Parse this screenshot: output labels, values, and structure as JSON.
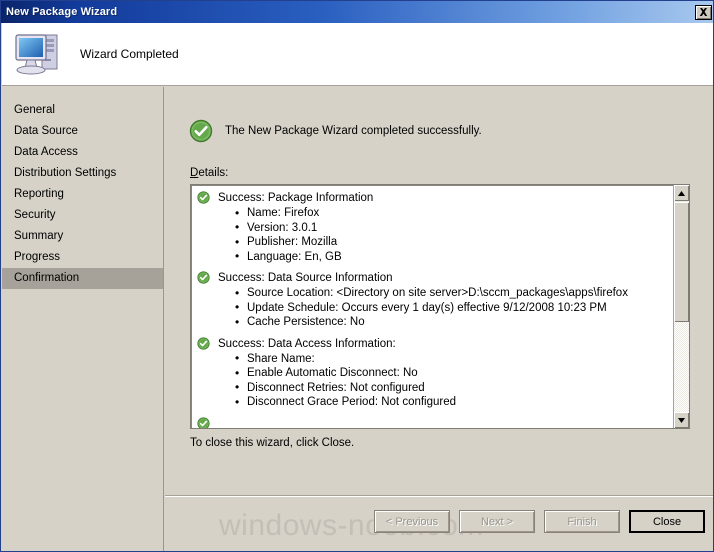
{
  "window": {
    "title": "New Package Wizard",
    "close_icon": "close-x-icon"
  },
  "header": {
    "icon": "computer-icon",
    "title": "Wizard Completed"
  },
  "sidebar": {
    "items": [
      {
        "label": "General",
        "selected": false
      },
      {
        "label": "Data Source",
        "selected": false
      },
      {
        "label": "Data Access",
        "selected": false
      },
      {
        "label": "Distribution Settings",
        "selected": false
      },
      {
        "label": "Reporting",
        "selected": false
      },
      {
        "label": "Security",
        "selected": false
      },
      {
        "label": "Summary",
        "selected": false
      },
      {
        "label": "Progress",
        "selected": false
      },
      {
        "label": "Confirmation",
        "selected": true
      }
    ]
  },
  "content": {
    "result_icon": "success-check-icon",
    "result_text": "The New Package Wizard completed successfully.",
    "details_label_accel": "D",
    "details_label_rest": "etails:",
    "close_hint": "To close this wizard, click Close.",
    "details": [
      {
        "icon": "success-check-icon",
        "heading": "Success: Package Information",
        "bullets": [
          "Name: Firefox",
          "Version: 3.0.1",
          "Publisher: Mozilla",
          "Language: En, GB"
        ]
      },
      {
        "icon": "success-check-icon",
        "heading": "Success: Data Source Information",
        "bullets": [
          "Source Location: <Directory on site server>D:\\sccm_packages\\apps\\firefox",
          "Update Schedule: Occurs every 1 day(s) effective 9/12/2008 10:23 PM",
          "Cache Persistence: No"
        ]
      },
      {
        "icon": "success-check-icon",
        "heading": "Success: Data Access Information:",
        "bullets": [
          "Share Name:",
          "Enable Automatic Disconnect: No",
          "Disconnect Retries: Not configured",
          "Disconnect Grace Period: Not configured"
        ]
      }
    ],
    "scrollbar": {
      "up_icon": "scroll-up-arrow-icon",
      "down_icon": "scroll-down-arrow-icon"
    }
  },
  "footer": {
    "buttons": [
      {
        "label": "< Previous",
        "accel": "P",
        "disabled": true,
        "default": false
      },
      {
        "label": "Next >",
        "accel": "N",
        "disabled": true,
        "default": false
      },
      {
        "label": "Finish",
        "accel": "F",
        "disabled": true,
        "default": false
      },
      {
        "label": "Close",
        "accel": "",
        "disabled": false,
        "default": true
      }
    ]
  },
  "watermark": {
    "text": "windows-noob.com"
  },
  "colors": {
    "title_start": "#0a246a",
    "title_end": "#a9c9ef",
    "face": "#d6d2c8",
    "selected": "#a6a299",
    "success_green": "#4e9a3e"
  }
}
